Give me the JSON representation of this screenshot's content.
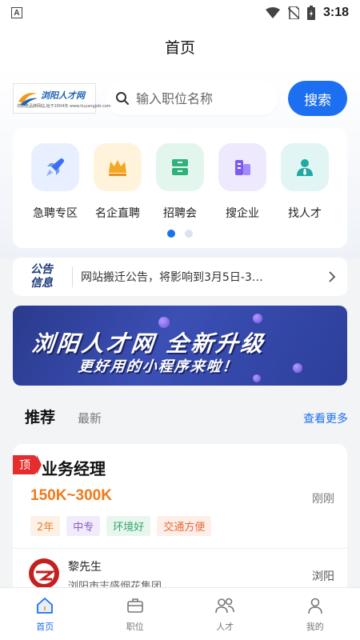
{
  "status_bar": {
    "time": "3:18",
    "indicator": "A"
  },
  "nav": {
    "title": "首页"
  },
  "logo": {
    "name": "浏阳人才网",
    "subtitle": "浏阳老品牌网站,始于2004年 www.liuyangjob.com"
  },
  "search": {
    "placeholder": "输入职位名称",
    "button_label": "搜索"
  },
  "categories": [
    {
      "label": "急聘专区",
      "icon": "rocket-icon"
    },
    {
      "label": "名企直聘",
      "icon": "crown-icon"
    },
    {
      "label": "招聘会",
      "icon": "drawer-icon"
    },
    {
      "label": "搜企业",
      "icon": "building-icon"
    },
    {
      "label": "找人才",
      "icon": "person-icon"
    }
  ],
  "notice": {
    "tag_line1": "公告",
    "tag_line2": "信息",
    "text": "网站搬迁公告，将影响到3月5日-3…"
  },
  "banner": {
    "line1": "浏阳人才网 全新升级",
    "line2": "更好用的小程序来啦！"
  },
  "tabs": {
    "active": "推荐",
    "other": "最新",
    "more": "查看更多"
  },
  "job": {
    "badge": "顶",
    "title": "业务经理",
    "salary": "150K~300K",
    "posted": "刚刚",
    "tags": [
      "2年",
      "中专",
      "环境好",
      "交通方便"
    ],
    "contact": "黎先生",
    "company": "浏阳市志盛烟花集团",
    "city": "浏阳"
  },
  "bottom_nav": [
    {
      "label": "首页",
      "active": true
    },
    {
      "label": "职位",
      "active": false
    },
    {
      "label": "人才",
      "active": false
    },
    {
      "label": "我的",
      "active": false
    }
  ],
  "colors": {
    "primary": "#1d6ff2",
    "salary": "#f07a1a",
    "badge": "#e52d2d"
  }
}
